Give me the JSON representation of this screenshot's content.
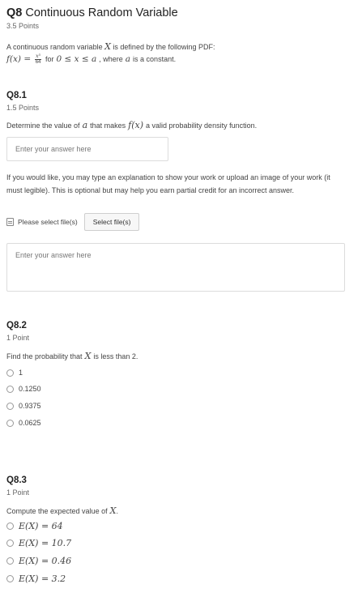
{
  "question": {
    "title_bold": "Q8",
    "title_text": " Continuous Random Variable",
    "points": "3.5 Points",
    "intro_line1_pre": "A continuous random variable ",
    "intro_var": "X",
    "intro_line1_post": " is defined by the following PDF:",
    "pdf_lhs": "f(x) =",
    "pdf_num": "x³",
    "pdf_den": "64",
    "pdf_for": "for",
    "pdf_range": "0 ≤ x ≤ a",
    "pdf_post": ", where",
    "pdf_a": "a",
    "pdf_const": "is a constant."
  },
  "q81": {
    "title": "Q8.1",
    "points": "1.5 Points",
    "prompt_pre": "Determine the value of ",
    "prompt_var": "a",
    "prompt_mid": " that makes ",
    "prompt_fx": "f(x)",
    "prompt_post": " a valid probability density function.",
    "answer_placeholder": "Enter your answer here",
    "explain_text": "If you would like, you may type an explanation to show your work or upload an image of your work (it must legible). This is optional but may help you earn partial credit for an incorrect answer.",
    "file_status": "Please select file(s)",
    "select_files_label": "Select file(s)",
    "explain_placeholder": "Enter your answer here"
  },
  "q82": {
    "title": "Q8.2",
    "points": "1 Point",
    "prompt_pre": "Find the probability that ",
    "prompt_var": "X",
    "prompt_post": " is less than 2.",
    "options": [
      "1",
      "0.1250",
      "0.9375",
      "0.0625"
    ]
  },
  "q83": {
    "title": "Q8.3",
    "points": "1 Point",
    "prompt_pre": "Compute the expected value of ",
    "prompt_var": "X",
    "prompt_post": ".",
    "options": [
      "E(X) = 64",
      "E(X) = 10.7",
      "E(X) = 0.46",
      "E(X) = 3.2"
    ]
  }
}
